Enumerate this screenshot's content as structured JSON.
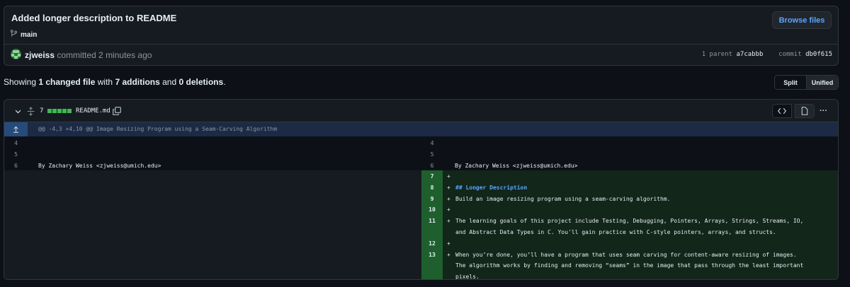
{
  "commit": {
    "title": "Added longer description to README",
    "branch": "main",
    "browse_label": "Browse files",
    "author": "zjweiss",
    "action_text": "committed 2 minutes ago",
    "parent_label": "1 parent",
    "parent_sha": "a7cabbb",
    "commit_label": "commit",
    "commit_sha": "db0f615"
  },
  "summary": {
    "prefix": "Showing",
    "changed": "1 changed file",
    "with": "with",
    "additions": "7 additions",
    "and": "and",
    "deletions": "0 deletions",
    "suffix": "."
  },
  "view_toggle": {
    "split": "Split",
    "unified": "Unified"
  },
  "file": {
    "change_count": "7",
    "name": "README.md",
    "hunk_header": "@@ -4,3 +4,10 @@ Image Resizing Program using a Seam-Carving Algorithm",
    "more_label": "···"
  },
  "left_lines": [
    {
      "num": "4",
      "text": ""
    },
    {
      "num": "5",
      "text": ""
    },
    {
      "num": "6",
      "text": "By Zachary Weiss <zjweiss@umich.edu>"
    }
  ],
  "right_context": [
    {
      "num": "4",
      "text": ""
    },
    {
      "num": "5",
      "text": ""
    },
    {
      "num": "6",
      "text": "By Zachary Weiss <zjweiss@umich.edu>"
    }
  ],
  "right_added": [
    {
      "num": "7",
      "sign": "+",
      "lines": [
        ""
      ]
    },
    {
      "num": "8",
      "sign": "+",
      "lines": [
        "## Longer Description"
      ],
      "heading": true
    },
    {
      "num": "9",
      "sign": "+",
      "lines": [
        "Build an image resizing program using a seam-carving algorithm."
      ]
    },
    {
      "num": "10",
      "sign": "+",
      "lines": [
        ""
      ]
    },
    {
      "num": "11",
      "sign": "+",
      "lines": [
        "The learning goals of this project include Testing, Debugging, Pointers, Arrays, Strings, Streams, IO,",
        "and Abstract Data Types in C. You'll gain practice with C-style pointers, arrays, and structs."
      ]
    },
    {
      "num": "12",
      "sign": "+",
      "lines": [
        ""
      ]
    },
    {
      "num": "13",
      "sign": "+",
      "lines": [
        "When you’re done, you’ll have a program that uses seam carving for content-aware resizing of images.",
        "The algorithm works by finding and removing “seams” in the image that pass through the least important",
        "pixels."
      ]
    }
  ],
  "colors": {
    "addition_green": "#3fb950",
    "link_blue": "#58a6ff",
    "background": "#0d1117"
  }
}
